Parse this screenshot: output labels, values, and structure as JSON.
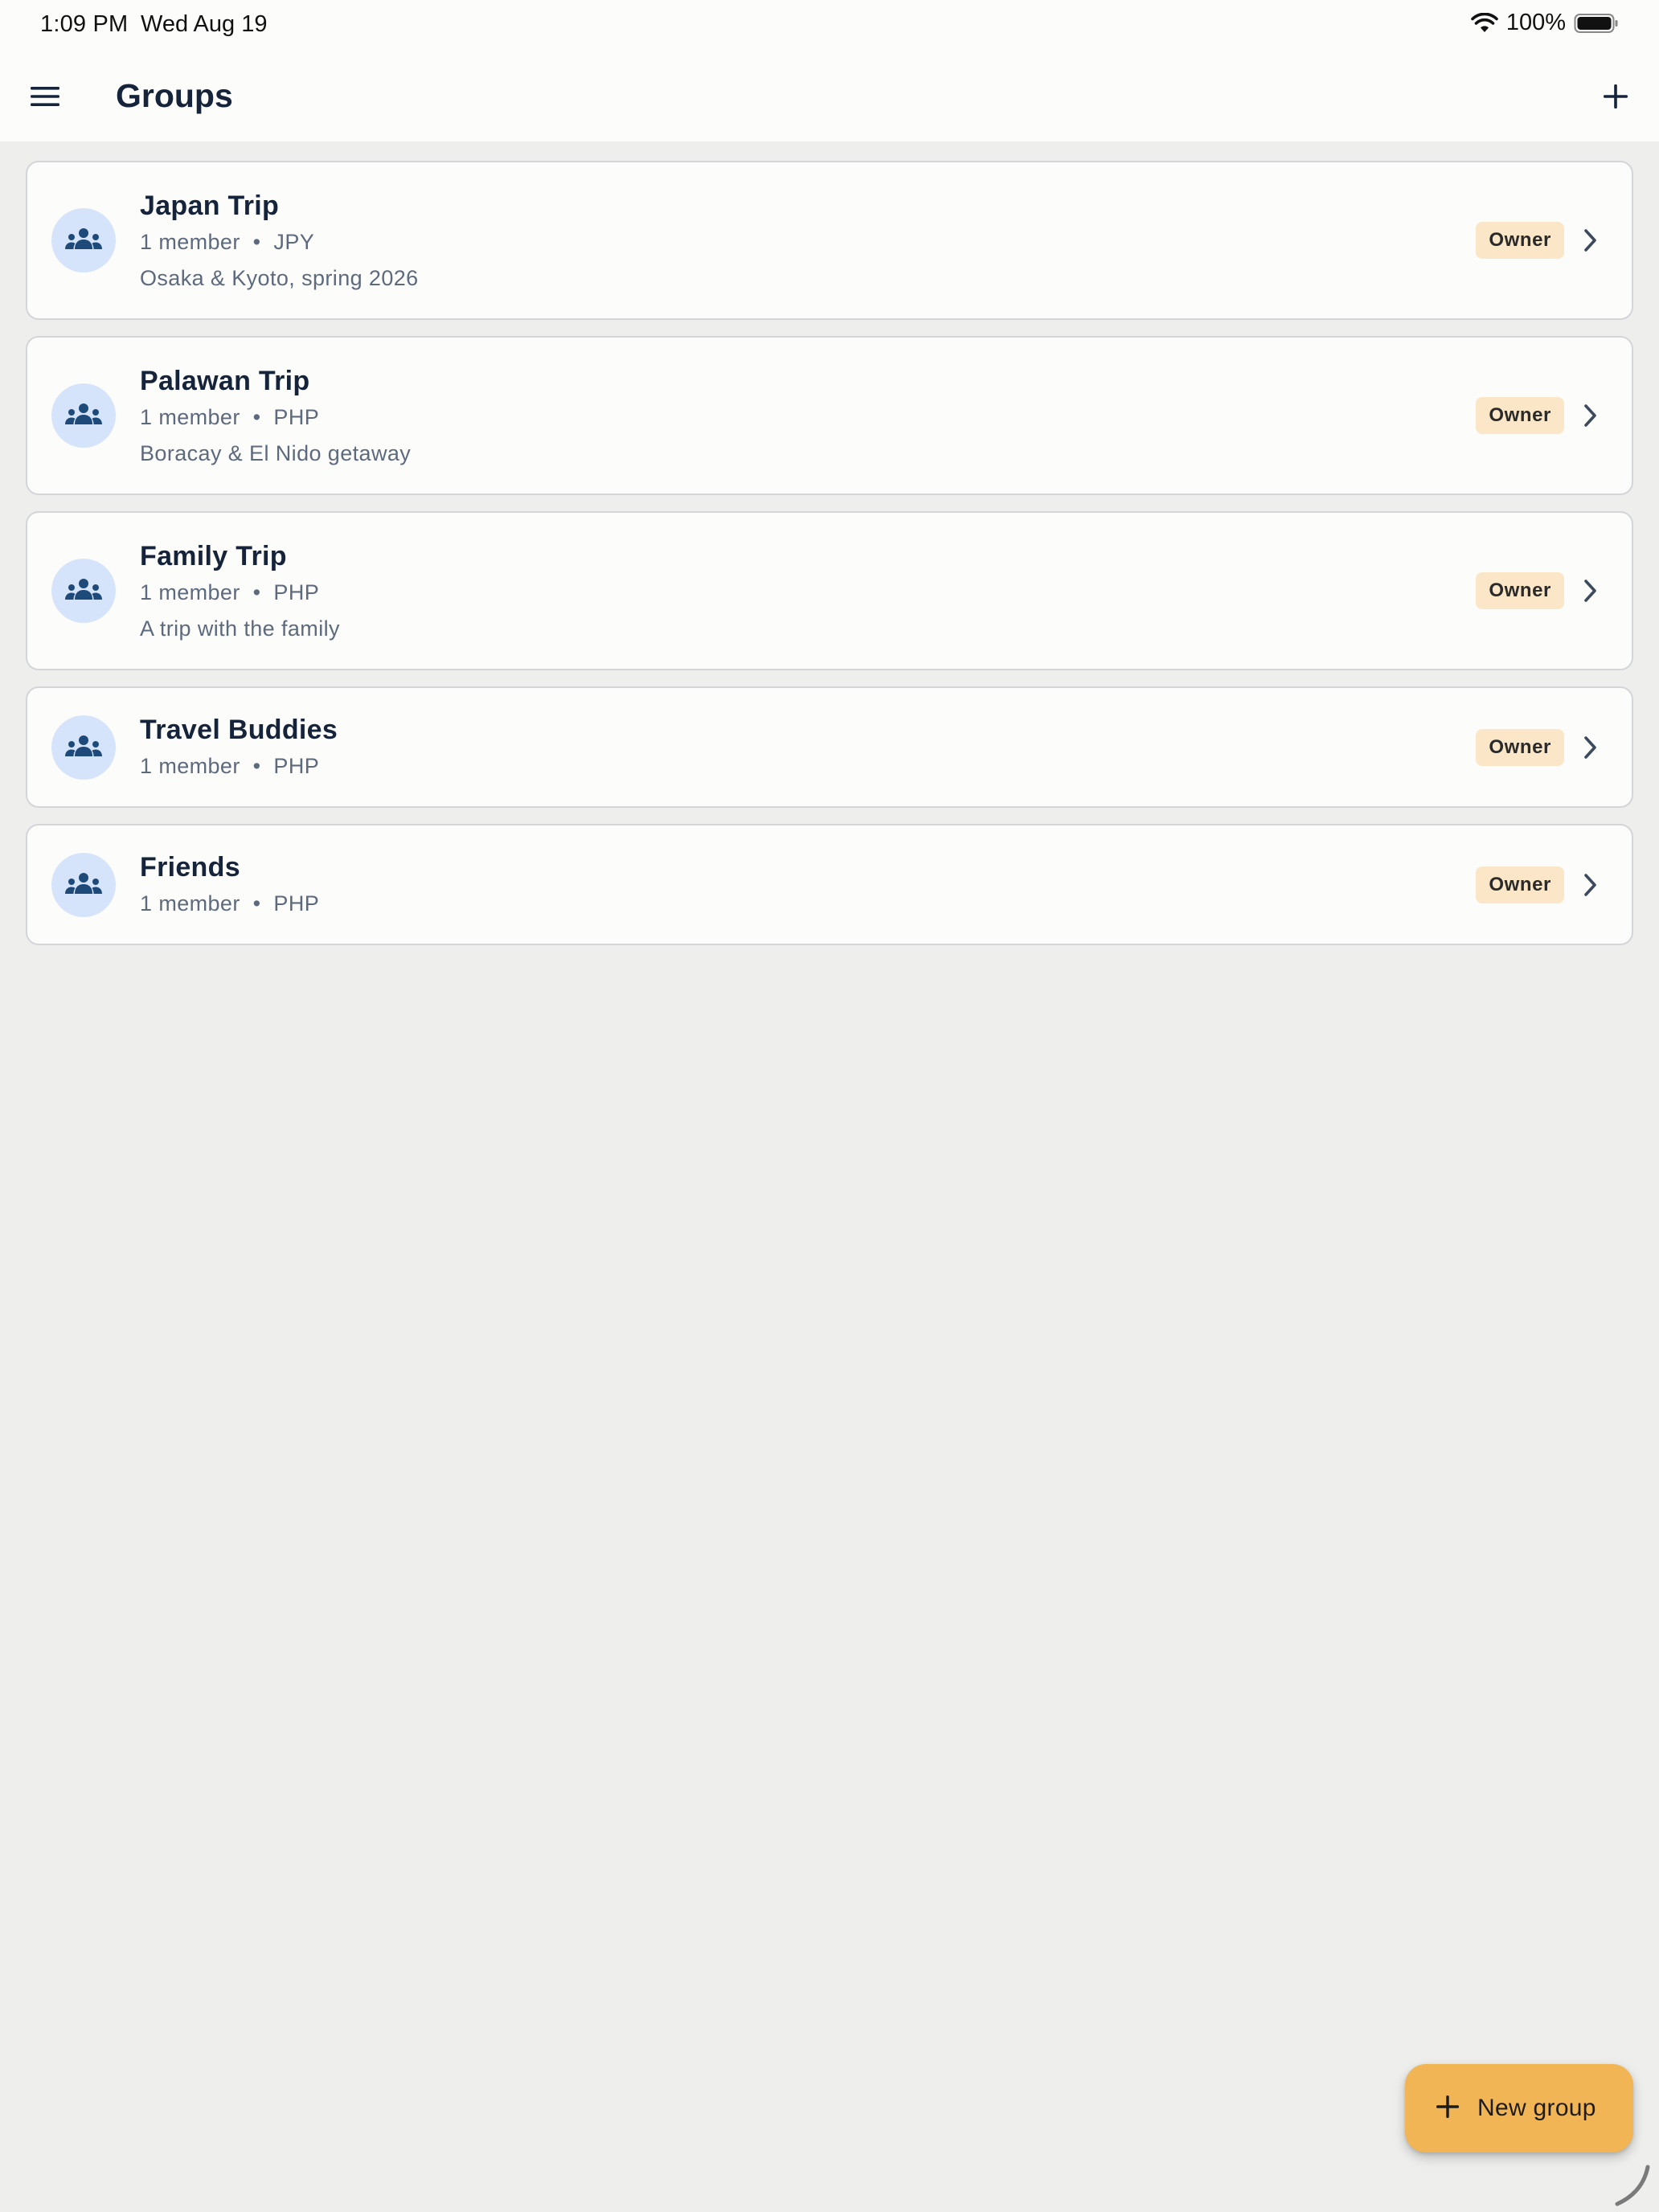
{
  "status_bar": {
    "time": "1:09 PM",
    "date": "Wed Aug 19",
    "battery": "100%"
  },
  "app_bar": {
    "title": "Groups",
    "menu_icon": "hamburger-menu-icon",
    "add_icon": "plus-icon"
  },
  "groups": [
    {
      "name": "Japan Trip",
      "members": "1 member",
      "separator": "•",
      "currency": "JPY",
      "description": "Osaka & Kyoto, spring 2026",
      "role": "Owner"
    },
    {
      "name": "Palawan Trip",
      "members": "1 member",
      "separator": "•",
      "currency": "PHP",
      "description": "Boracay & El Nido getaway",
      "role": "Owner"
    },
    {
      "name": "Family Trip",
      "members": "1 member",
      "separator": "•",
      "currency": "PHP",
      "description": "A trip with the family",
      "role": "Owner"
    },
    {
      "name": "Travel Buddies",
      "members": "1 member",
      "separator": "•",
      "currency": "PHP",
      "role": "Owner"
    },
    {
      "name": "Friends",
      "members": "1 member",
      "separator": "•",
      "currency": "PHP",
      "role": "Owner"
    }
  ],
  "fab": {
    "label": "New group",
    "icon": "plus-icon"
  },
  "colors": {
    "background": "#eeeeec",
    "surface": "#fcfcfa",
    "primary_text": "#15243a",
    "secondary_text": "#5d6a7e",
    "avatar_bg": "#d6e4fb",
    "avatar_icon": "#1e4a7a",
    "badge_bg": "#fbe7c7",
    "fab_bg": "#f1b556"
  }
}
